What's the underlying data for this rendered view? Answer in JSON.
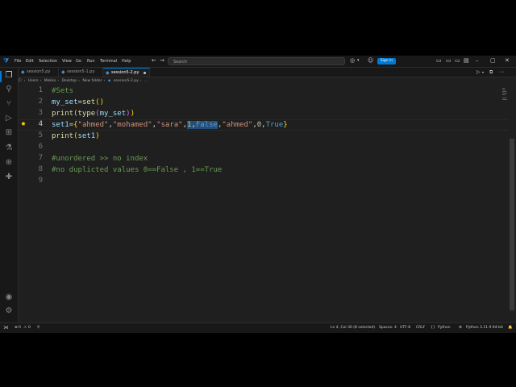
{
  "titlebar": {
    "menus": [
      "File",
      "Edit",
      "Selection",
      "View",
      "Go",
      "Run",
      "Terminal",
      "Help"
    ],
    "search_placeholder": "Search",
    "signin_label": "Sign in"
  },
  "tabs": [
    {
      "label": "session5.py",
      "active": false
    },
    {
      "label": "session5-1.py",
      "active": false
    },
    {
      "label": "session5-2.py",
      "active": true
    }
  ],
  "breadcrumb": [
    "C:",
    "Users",
    "Mekko",
    "Desktop",
    "New folder",
    "session5-2.py",
    "..."
  ],
  "editor": {
    "line_numbers": [
      "1",
      "2",
      "3",
      "4",
      "5",
      "6",
      "7",
      "8",
      "9"
    ],
    "current_line": "4",
    "lines": {
      "l1": {
        "comment": "#Sets"
      },
      "l2": {
        "var": "my_set",
        "eq": "=",
        "fn": "set",
        "paren": "()"
      },
      "l3": {
        "fn": "print",
        "open": "(",
        "fn2": "type",
        "open2": "(",
        "var": "my_set",
        "close2": ")",
        "close": ")"
      },
      "l4": {
        "var": "set1",
        "eq": "=",
        "open": "{",
        "s1": "\"ahmed\"",
        "c1": ",",
        "s2": "\"mohamed\"",
        "c2": ",",
        "s3": "\"sara\"",
        "c3": ",",
        "n1": "1",
        "c4": ",",
        "k1": "False",
        "c5": ",",
        "s4": "\"ahmed\"",
        "c6": ",",
        "n2": "0",
        "c7": ",",
        "k2": "True",
        "close": "}"
      },
      "l5": {
        "fn": "print",
        "open": "(",
        "var": "set1",
        "close": ")"
      },
      "l7": {
        "comment": "#unordered >> no index"
      },
      "l8": {
        "comment": "#no duplicted values 0==False , 1==True"
      }
    }
  },
  "statusbar": {
    "errors": "0",
    "warnings": "0",
    "cursor": "Ln 4, Col 30 (8 selected)",
    "spaces": "Spaces: 4",
    "encoding": "UTF-8",
    "eol": "CRLF",
    "braces": "{}",
    "language": "Python",
    "interpreter": "Python 3.11.9 64-bit"
  },
  "colors": {
    "accent": "#0078d4",
    "background": "#1f1f1f"
  }
}
